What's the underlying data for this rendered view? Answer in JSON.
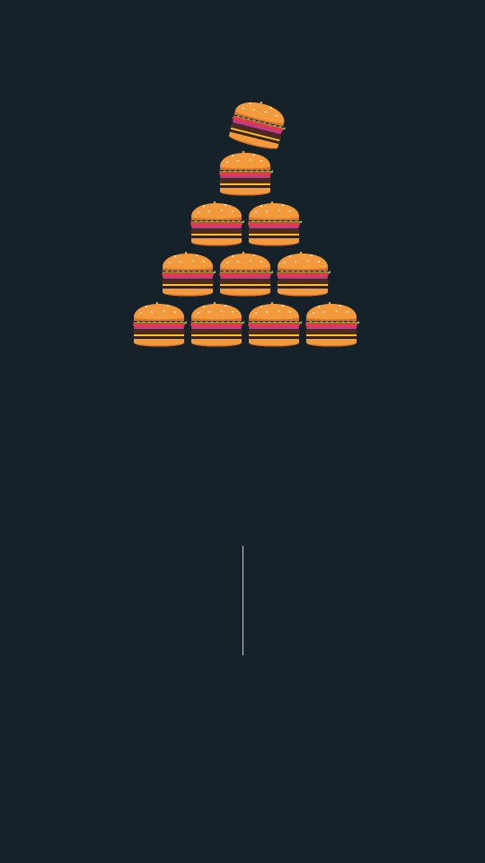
{
  "game": {
    "item_icon": "hamburger-icon",
    "rows": [
      {
        "count": 4
      },
      {
        "count": 3
      },
      {
        "count": 2
      },
      {
        "count": 1
      }
    ],
    "falling_item": {
      "icon": "hamburger-icon"
    },
    "colors": {
      "background": "#162229",
      "bun": "#f39b3c",
      "bun_shadow": "#d8742a",
      "lettuce": "#8bc34a",
      "tomato": "#e63a4b",
      "onion": "#c23b8e",
      "cheese": "#ffc21a",
      "patty": "#4a2a22",
      "divider": "#c9cfd3"
    }
  }
}
